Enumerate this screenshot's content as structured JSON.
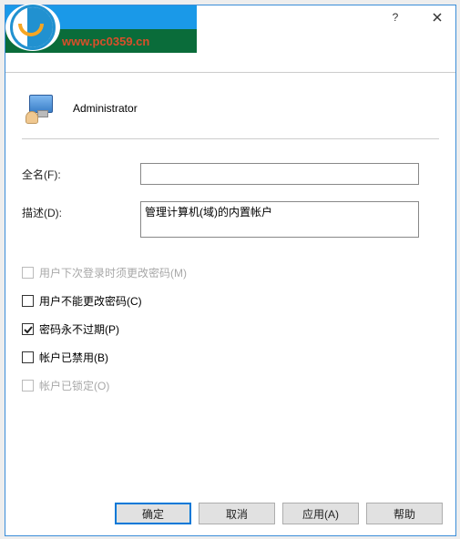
{
  "watermark_url": "www.pc0359.cn",
  "header": {
    "username": "Administrator"
  },
  "form": {
    "fullname_label": "全名(F):",
    "fullname_value": "",
    "description_label": "描述(D):",
    "description_value": "管理计算机(域)的内置帐户"
  },
  "checkboxes": {
    "must_change": {
      "label": "用户下次登录时须更改密码(M)",
      "checked": false,
      "enabled": false
    },
    "cannot_change": {
      "label": "用户不能更改密码(C)",
      "checked": false,
      "enabled": true
    },
    "never_expire": {
      "label": "密码永不过期(P)",
      "checked": true,
      "enabled": true
    },
    "disabled": {
      "label": "帐户已禁用(B)",
      "checked": false,
      "enabled": true
    },
    "locked": {
      "label": "帐户已锁定(O)",
      "checked": false,
      "enabled": false
    }
  },
  "buttons": {
    "ok": "确定",
    "cancel": "取消",
    "apply": "应用(A)",
    "help": "帮助"
  },
  "titlebar": {
    "help_glyph": "?"
  }
}
